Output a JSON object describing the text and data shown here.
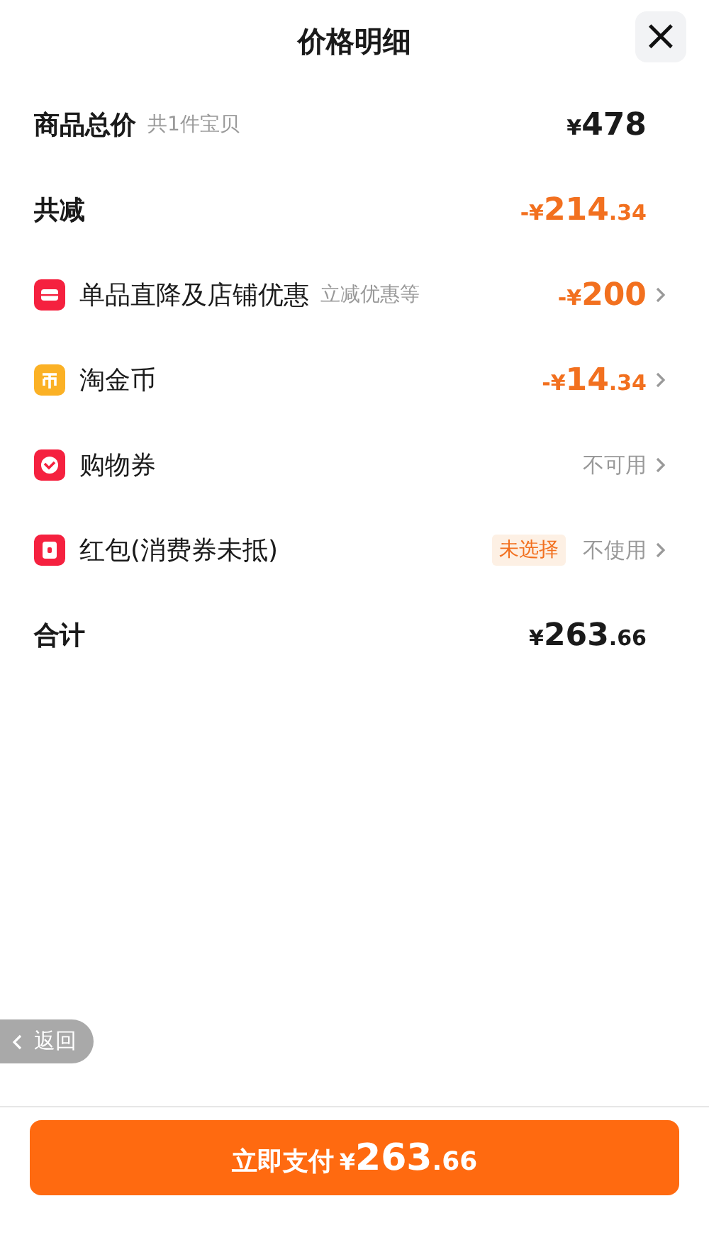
{
  "header": {
    "title": "价格明细",
    "close_label": "×"
  },
  "rows": [
    {
      "kind": "summary",
      "label": "商品总价",
      "note": "共1件宝贝",
      "amount": {
        "prefix": "¥",
        "main": "478",
        "highlight": false
      }
    },
    {
      "kind": "summary",
      "label": "共减",
      "amount": {
        "prefix": "-¥",
        "main": "214",
        "fraction": ".34",
        "highlight": true
      }
    },
    {
      "kind": "benefit",
      "label": "单品直降及店铺优惠",
      "note": "立减优惠等",
      "amount": {
        "prefix": "-¥",
        "main": "200",
        "highlight": true
      }
    },
    {
      "kind": "benefit",
      "label": "淘金币",
      "amount": {
        "prefix": "-¥",
        "main": "14",
        "fraction": ".34",
        "highlight": true
      }
    },
    {
      "kind": "benefit",
      "label": "购物券",
      "status": "不可用"
    },
    {
      "kind": "benefit",
      "label": "红包(消费券未抵)",
      "tag": "未选择",
      "status": "不使用"
    },
    {
      "kind": "summary",
      "label": "合计",
      "amount": {
        "prefix": "¥",
        "main": "263",
        "fraction": ".66",
        "highlight": false
      }
    }
  ],
  "back_button": {
    "label": "返回"
  },
  "pay_button": {
    "label": "立即支付",
    "prefix": "¥",
    "main": "263",
    "fraction": ".66"
  }
}
